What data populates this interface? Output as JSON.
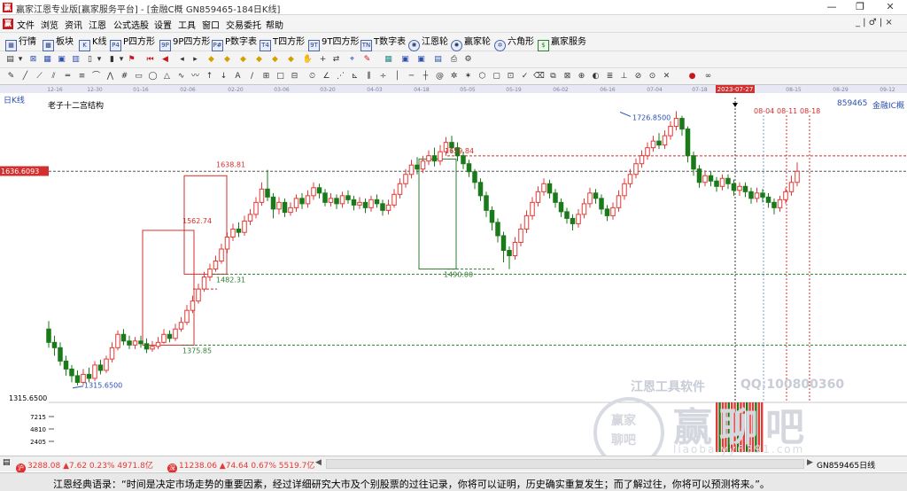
{
  "window": {
    "title": "赢家江恩专业版[赢家服务平台] - [金融C概  GN859465-184日K线]",
    "minimize": "—",
    "maximize": "❐",
    "close": "✕"
  },
  "menu": {
    "items": [
      "文件",
      "浏览",
      "资讯",
      "江恩",
      "公式选股",
      "设置",
      "工具",
      "窗口",
      "交易委托",
      "帮助"
    ],
    "mdi_controls": "_ | ♂ | ×"
  },
  "toolbar_main": {
    "items": [
      {
        "label": "行情",
        "icon": "grid-icon"
      },
      {
        "label": "板块",
        "icon": "blocks-icon"
      },
      {
        "label": "K线",
        "icon": "kline-icon"
      },
      {
        "label": "P四方形",
        "icon": "p-square-icon",
        "badge": "P4"
      },
      {
        "label": "9P四方形",
        "icon": "9p-square-icon",
        "badge": "9P"
      },
      {
        "label": "P数字表",
        "icon": "p-table-icon",
        "badge": "P#"
      },
      {
        "label": "T四方形",
        "icon": "t-square-icon",
        "badge": "T4"
      },
      {
        "label": "9T四方形",
        "icon": "9t-square-icon",
        "badge": "9T"
      },
      {
        "label": "T数字表",
        "icon": "t-table-icon",
        "badge": "TN"
      },
      {
        "label": "江恩轮",
        "icon": "gann-wheel-icon"
      },
      {
        "label": "赢家轮",
        "icon": "winner-wheel-icon"
      },
      {
        "label": "六角形",
        "icon": "hexagon-icon"
      },
      {
        "label": "赢家服务",
        "icon": "dollar-icon"
      }
    ]
  },
  "chart_header": {
    "period_label": "日K线",
    "structure_label": "老子十二宫结构",
    "right_code": "859465",
    "right_name": "金融IC概",
    "price_tag": "1636.6093",
    "left_low_label": "1315.6500",
    "highlight_date": "2023-07-27",
    "future_dates": [
      "08-04",
      "08-11",
      "08-18"
    ]
  },
  "date_axis": [
    "12-16",
    "12-30",
    "01-16",
    "02-06",
    "02-20",
    "03-06",
    "03-20",
    "04-03",
    "04-18",
    "05-05",
    "05-19",
    "06-02",
    "06-16",
    "07-04",
    "07-18",
    "2023-07-27",
    "08-15",
    "08-29",
    "09-12"
  ],
  "price_annotations": {
    "high": "1726.8500",
    "low": "1315.6500",
    "box1_top": "1638.81",
    "box1_mid": "1562.74",
    "box1_bottom": "1482.31",
    "box2_top": "1659.84",
    "box2_bottom": "1490.00",
    "lower_box_bottom": "1375.85"
  },
  "chart_data": {
    "type": "candlestick",
    "x_start": "2022-12-12",
    "ylim": [
      1290,
      1750
    ],
    "candles": [
      [
        1400,
        1380,
        1412,
        1372
      ],
      [
        1380,
        1372,
        1390,
        1360
      ],
      [
        1372,
        1352,
        1380,
        1345
      ],
      [
        1352,
        1340,
        1360,
        1330
      ],
      [
        1340,
        1330,
        1346,
        1320
      ],
      [
        1330,
        1320,
        1338,
        1315.65
      ],
      [
        1320,
        1332,
        1340,
        1316
      ],
      [
        1332,
        1326,
        1342,
        1320
      ],
      [
        1326,
        1346,
        1352,
        1322
      ],
      [
        1346,
        1338,
        1354,
        1332
      ],
      [
        1338,
        1355,
        1360,
        1334
      ],
      [
        1355,
        1372,
        1380,
        1350
      ],
      [
        1372,
        1392,
        1398,
        1368
      ],
      [
        1392,
        1382,
        1400,
        1376
      ],
      [
        1382,
        1376,
        1390,
        1370
      ],
      [
        1376,
        1382,
        1388,
        1370
      ],
      [
        1382,
        1378,
        1390,
        1372
      ],
      [
        1378,
        1370,
        1386,
        1364
      ],
      [
        1370,
        1374,
        1382,
        1366
      ],
      [
        1374,
        1380,
        1388,
        1370
      ],
      [
        1380,
        1392,
        1400,
        1378
      ],
      [
        1392,
        1386,
        1398,
        1380
      ],
      [
        1386,
        1400,
        1408,
        1382
      ],
      [
        1400,
        1410,
        1418,
        1396
      ],
      [
        1410,
        1428,
        1436,
        1406
      ],
      [
        1428,
        1442,
        1450,
        1424
      ],
      [
        1442,
        1460,
        1468,
        1438
      ],
      [
        1460,
        1478,
        1486,
        1456
      ],
      [
        1478,
        1490,
        1498,
        1472
      ],
      [
        1490,
        1502,
        1510,
        1486
      ],
      [
        1502,
        1520,
        1528,
        1498
      ],
      [
        1520,
        1538,
        1545,
        1514
      ],
      [
        1538,
        1550,
        1558,
        1532
      ],
      [
        1550,
        1545,
        1560,
        1538
      ],
      [
        1545,
        1562,
        1570,
        1540
      ],
      [
        1562,
        1572,
        1580,
        1556
      ],
      [
        1572,
        1590,
        1598,
        1566
      ],
      [
        1590,
        1610,
        1620,
        1585
      ],
      [
        1610,
        1598,
        1638.81,
        1592
      ],
      [
        1598,
        1580,
        1604,
        1566
      ],
      [
        1580,
        1590,
        1598,
        1572
      ],
      [
        1590,
        1575,
        1596,
        1568
      ],
      [
        1575,
        1582,
        1590,
        1570
      ],
      [
        1582,
        1596,
        1602,
        1576
      ],
      [
        1596,
        1588,
        1604,
        1580
      ],
      [
        1588,
        1600,
        1608,
        1582
      ],
      [
        1600,
        1612,
        1620,
        1594
      ],
      [
        1612,
        1604,
        1618,
        1596
      ],
      [
        1604,
        1590,
        1610,
        1584
      ],
      [
        1590,
        1596,
        1604,
        1584
      ],
      [
        1596,
        1588,
        1602,
        1580
      ],
      [
        1588,
        1600,
        1606,
        1582
      ],
      [
        1600,
        1594,
        1608,
        1588
      ],
      [
        1594,
        1586,
        1600,
        1578
      ],
      [
        1586,
        1590,
        1598,
        1580
      ],
      [
        1590,
        1582,
        1596,
        1574
      ],
      [
        1582,
        1594,
        1600,
        1576
      ],
      [
        1594,
        1588,
        1602,
        1582
      ],
      [
        1588,
        1578,
        1594,
        1570
      ],
      [
        1578,
        1586,
        1594,
        1572
      ],
      [
        1586,
        1602,
        1610,
        1582
      ],
      [
        1602,
        1618,
        1626,
        1596
      ],
      [
        1618,
        1632,
        1640,
        1612
      ],
      [
        1632,
        1646,
        1654,
        1626
      ],
      [
        1646,
        1640,
        1658,
        1632
      ],
      [
        1640,
        1652,
        1660,
        1634
      ],
      [
        1652,
        1660,
        1668,
        1646
      ],
      [
        1660,
        1652,
        1672,
        1644
      ],
      [
        1652,
        1666,
        1676,
        1646
      ],
      [
        1666,
        1680,
        1688,
        1660
      ],
      [
        1680,
        1672,
        1690,
        1664
      ],
      [
        1672,
        1660,
        1680,
        1652
      ],
      [
        1660,
        1648,
        1666,
        1640
      ],
      [
        1648,
        1636,
        1654,
        1628
      ],
      [
        1636,
        1620,
        1640,
        1610
      ],
      [
        1620,
        1600,
        1626,
        1592
      ],
      [
        1600,
        1578,
        1606,
        1568
      ],
      [
        1578,
        1560,
        1584,
        1548
      ],
      [
        1560,
        1540,
        1566,
        1530
      ],
      [
        1540,
        1518,
        1546,
        1500
      ],
      [
        1518,
        1510,
        1524,
        1490
      ],
      [
        1510,
        1530,
        1538,
        1504
      ],
      [
        1530,
        1550,
        1558,
        1524
      ],
      [
        1550,
        1570,
        1578,
        1544
      ],
      [
        1570,
        1590,
        1598,
        1564
      ],
      [
        1590,
        1606,
        1614,
        1584
      ],
      [
        1606,
        1618,
        1626,
        1600
      ],
      [
        1618,
        1604,
        1624,
        1596
      ],
      [
        1604,
        1590,
        1610,
        1582
      ],
      [
        1590,
        1576,
        1596,
        1568
      ],
      [
        1576,
        1566,
        1582,
        1558
      ],
      [
        1566,
        1558,
        1572,
        1548
      ],
      [
        1558,
        1572,
        1580,
        1552
      ],
      [
        1572,
        1588,
        1596,
        1566
      ],
      [
        1588,
        1604,
        1612,
        1582
      ],
      [
        1604,
        1596,
        1610,
        1588
      ],
      [
        1596,
        1580,
        1602,
        1572
      ],
      [
        1580,
        1570,
        1586,
        1562
      ],
      [
        1570,
        1582,
        1590,
        1564
      ],
      [
        1582,
        1600,
        1608,
        1576
      ],
      [
        1600,
        1618,
        1626,
        1594
      ],
      [
        1618,
        1632,
        1640,
        1612
      ],
      [
        1632,
        1648,
        1656,
        1626
      ],
      [
        1648,
        1660,
        1668,
        1642
      ],
      [
        1660,
        1672,
        1680,
        1654
      ],
      [
        1672,
        1682,
        1690,
        1666
      ],
      [
        1682,
        1676,
        1694,
        1670
      ],
      [
        1676,
        1690,
        1698,
        1670
      ],
      [
        1690,
        1704,
        1712,
        1684
      ],
      [
        1704,
        1716,
        1726.85,
        1698
      ],
      [
        1716,
        1700,
        1720,
        1690
      ],
      [
        1700,
        1660,
        1704,
        1650
      ],
      [
        1660,
        1640,
        1666,
        1630
      ],
      [
        1640,
        1620,
        1646,
        1612
      ],
      [
        1620,
        1630,
        1638,
        1614
      ],
      [
        1630,
        1622,
        1636,
        1614
      ],
      [
        1622,
        1614,
        1628,
        1606
      ],
      [
        1614,
        1626,
        1632,
        1608
      ],
      [
        1626,
        1618,
        1632,
        1610
      ],
      [
        1618,
        1608,
        1624,
        1600
      ],
      [
        1608,
        1614,
        1620,
        1600
      ],
      [
        1614,
        1606,
        1620,
        1598
      ],
      [
        1606,
        1596,
        1612,
        1588
      ],
      [
        1596,
        1604,
        1612,
        1590
      ],
      [
        1604,
        1598,
        1610,
        1590
      ],
      [
        1598,
        1590,
        1604,
        1582
      ],
      [
        1590,
        1582,
        1596,
        1572
      ],
      [
        1582,
        1594,
        1600,
        1576
      ],
      [
        1594,
        1606,
        1612,
        1588
      ],
      [
        1606,
        1620,
        1630,
        1600
      ],
      [
        1620,
        1636.61,
        1650,
        1614
      ]
    ]
  },
  "volume_axis": {
    "labels": [
      "7215",
      "4810",
      "2405"
    ],
    "left_label": "1315.6500"
  },
  "watermark": {
    "line1": "江恩工具软件",
    "line2": "QQ:100800360",
    "brand": "赢聊吧",
    "domain": "liaoba.yy6391.com",
    "seal1": "赢家",
    "seal2": "聊吧"
  },
  "bottom_bar": {
    "index1": {
      "badge": "沪",
      "text": "3288.08 ▲7.62 0.23% 4971.8亿"
    },
    "index2": {
      "badge": "深",
      "text": "11238.06 ▲74.64 0.67% 5519.7亿"
    },
    "right_label": "GN859465日线"
  },
  "status_quote": "江恩经典语录：“时间是决定市场走势的重要因素，经过详细研究大市及个别股票的过往记录，你将可以证明，历史确实重复发生；而了解过往，你将可以预测将来。”。",
  "colors": {
    "up": "#e53935",
    "down": "#1a7a1a",
    "box_red": "#d32f2f",
    "box_green": "#2e7d32",
    "price_tag_bg": "#d32f2f",
    "date_axis_bg": "#e8e8f4",
    "highlight_date_bg": "#d32f2f"
  }
}
